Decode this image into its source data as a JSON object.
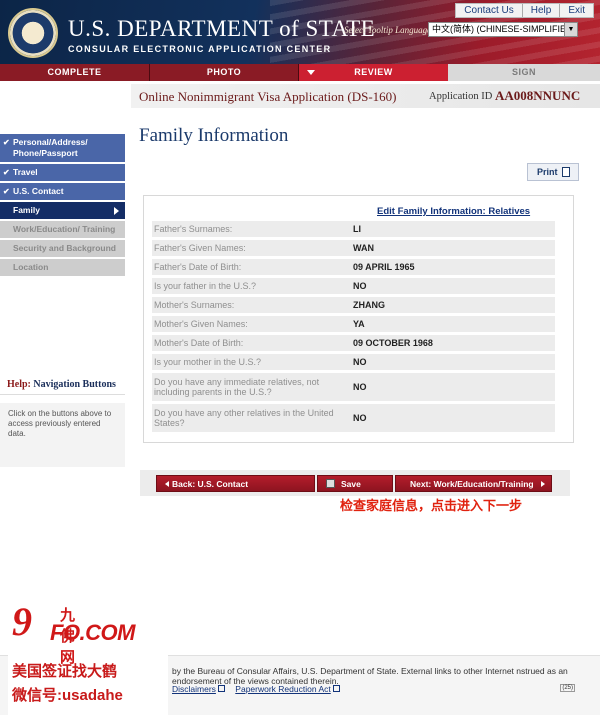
{
  "header": {
    "title": "U.S. DEPARTMENT of STATE",
    "subtitle": "CONSULAR ELECTRONIC APPLICATION CENTER",
    "links": [
      "Contact Us",
      "Help",
      "Exit"
    ],
    "language_label": "Select Tooltip Language",
    "language_value": "中文(简体) (CHINESE-SIMPLIFIED)"
  },
  "progress": {
    "steps": [
      "COMPLETE",
      "PHOTO",
      "REVIEW",
      "SIGN"
    ]
  },
  "application": {
    "title": "Online Nonimmigrant Visa Application (DS-160)",
    "id_label": "Application ID",
    "id": "AA008NNUNC"
  },
  "sidebar": {
    "items": [
      {
        "label": "Personal/Address/ Phone/Passport",
        "state": "done"
      },
      {
        "label": "Travel",
        "state": "done"
      },
      {
        "label": "U.S. Contact",
        "state": "done"
      },
      {
        "label": "Family",
        "state": "current"
      },
      {
        "label": "Work/Education/ Training",
        "state": "todo"
      },
      {
        "label": "Security and Background",
        "state": "todo"
      },
      {
        "label": "Location",
        "state": "todo"
      }
    ]
  },
  "help": {
    "title_lead": "Help:",
    "title_rest": "Navigation Buttons",
    "text": "Click on the buttons above to access previously entered data."
  },
  "main": {
    "page_title": "Family Information",
    "print_label": "Print",
    "edit_link": "Edit Family Information: Relatives",
    "rows": [
      {
        "label": "Father's Surnames:",
        "value": "LI"
      },
      {
        "label": "Father's Given Names:",
        "value": "WAN"
      },
      {
        "label": "Father's Date of Birth:",
        "value": "09 APRIL 1965"
      },
      {
        "label": "Is your father in the U.S.?",
        "value": "NO"
      },
      {
        "label": "Mother's Surnames:",
        "value": "ZHANG"
      },
      {
        "label": "Mother's Given Names:",
        "value": "YA"
      },
      {
        "label": "Mother's Date of Birth:",
        "value": "09 OCTOBER 1968"
      },
      {
        "label": "Is your mother in the U.S.?",
        "value": "NO"
      },
      {
        "label": "Do you have any immediate relatives, not including parents in the U.S.?",
        "value": "NO"
      },
      {
        "label": "Do you have any other relatives in the United States?",
        "value": "NO"
      }
    ]
  },
  "buttons": {
    "back": "Back: U.S. Contact",
    "save": "Save",
    "next": "Next: Work/Education/Training"
  },
  "annotation": "检查家庭信息，点击进入下一步",
  "footer": {
    "text": "by the Bureau of Consular Affairs, U.S. Department of State. External links to other Internet nstrued as an endorsement of the views contained therein.",
    "links": [
      "Disclaimers",
      "Paperwork Reduction Act"
    ],
    "page_num": "(25)"
  },
  "watermark": {
    "logo_num": "9",
    "logo_cn": "九佛网",
    "logo_text": "FO.COM",
    "line1": "美国签证找大鹤",
    "line2": "微信号:usadahe"
  },
  "colors": {
    "header_navy": "#12315c",
    "header_red": "#b4242f",
    "nav_done": "#4a66a8",
    "nav_current": "#142d66",
    "button_red": "#b41d2b",
    "annotation_red": "#e0220f"
  }
}
